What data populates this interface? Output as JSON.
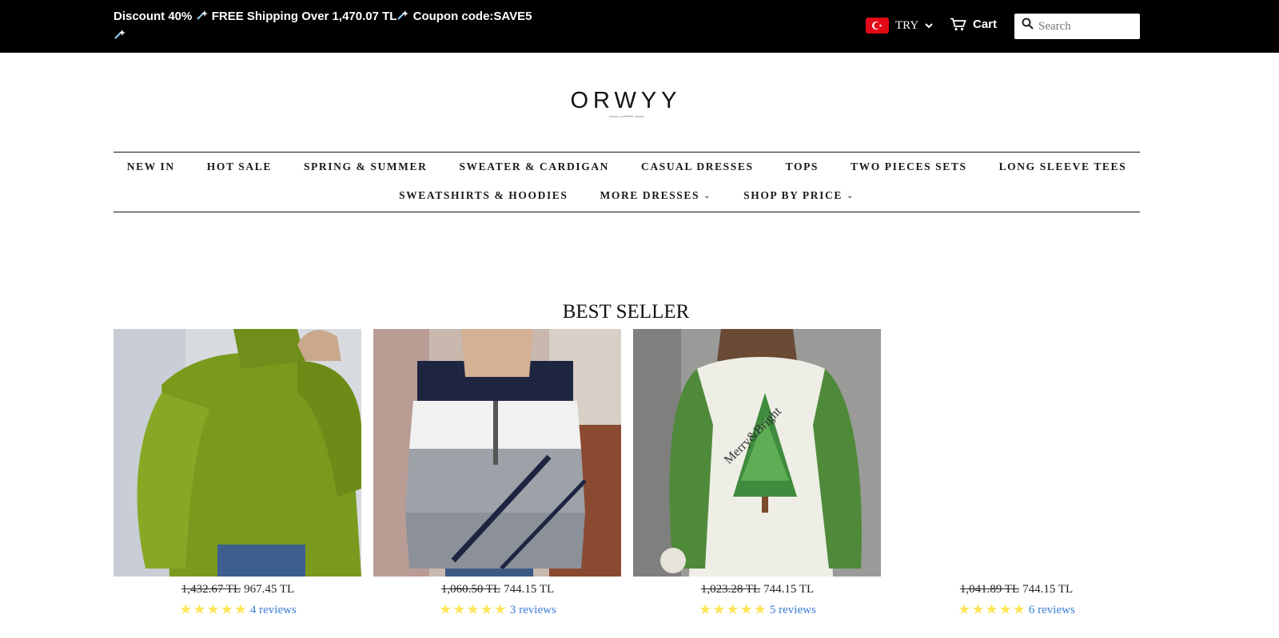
{
  "announcement": {
    "part1": "Discount 40%",
    "part2": "FREE Shipping Over 1,470.07 TL",
    "part3": "Coupon code:SAVE5"
  },
  "currency": {
    "label": "TRY"
  },
  "cart": {
    "label": "Cart"
  },
  "search": {
    "placeholder": "Search"
  },
  "logo": {
    "text": "ORWYY"
  },
  "nav": {
    "row1": [
      "NEW IN",
      "HOT SALE",
      "SPRING & SUMMER",
      "SWEATER & CARDIGAN",
      "CASUAL DRESSES",
      "TOPS",
      "TWO PIECES SETS",
      "LONG SLEEVE TEES"
    ],
    "row2": [
      "SWEATSHIRTS & HOODIES",
      "MORE DRESSES",
      "SHOP BY PRICE"
    ]
  },
  "section": {
    "title": "BEST SELLER"
  },
  "products": [
    {
      "old_price": "1,432.67 TL",
      "price": "967.45 TL",
      "reviews": "4 reviews",
      "rating": 5
    },
    {
      "old_price": "1,060.50 TL",
      "price": "744.15 TL",
      "reviews": "3 reviews",
      "rating": 5
    },
    {
      "old_price": "1,023.28 TL",
      "price": "744.15 TL",
      "reviews": "5 reviews",
      "rating": 5
    },
    {
      "old_price": "1,041.89 TL",
      "price": "744.15 TL",
      "reviews": "6 reviews",
      "rating": 5
    }
  ],
  "colors": {
    "topbar": "#000000",
    "star": "#ffe55a",
    "link": "#3a7bd5",
    "flag": "#e30a17"
  }
}
